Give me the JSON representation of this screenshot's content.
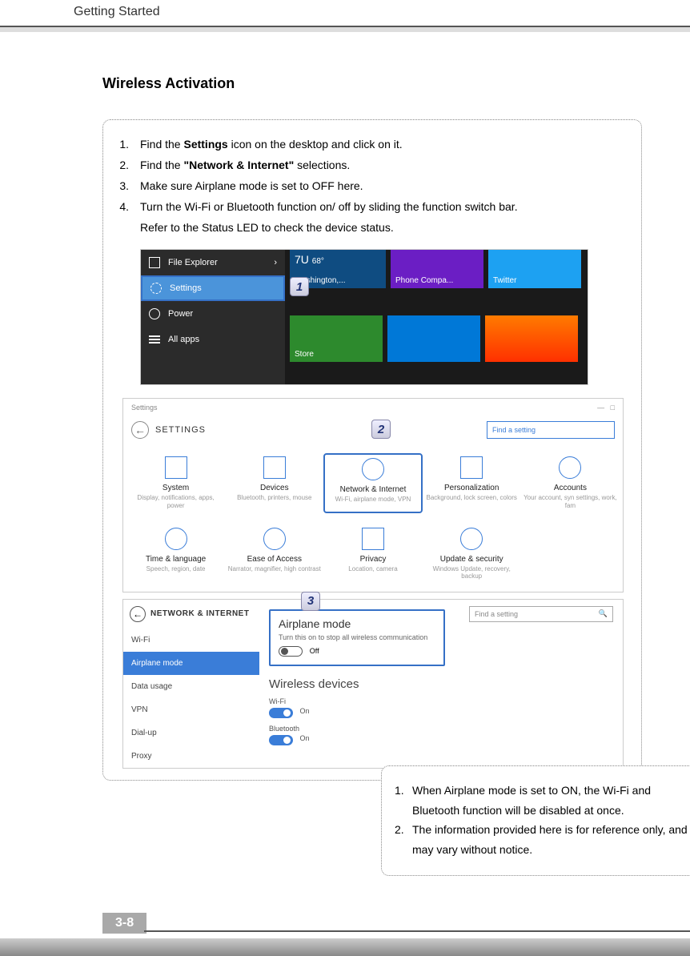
{
  "header": {
    "chapter": "Getting Started"
  },
  "section_title": "Wireless Activation",
  "steps": [
    {
      "num": "1.",
      "pre": "Find the ",
      "bold": "Settings",
      "post": " icon on the desktop and click on it."
    },
    {
      "num": "2.",
      "pre": "Find the ",
      "bold": "\"Network & Internet\"",
      "post": " selections."
    },
    {
      "num": "3.",
      "pre": "Make sure Airplane mode is set to OFF here.",
      "bold": "",
      "post": ""
    },
    {
      "num": "4.",
      "pre": "Turn the Wi-Fi or Bluetooth function on/ off by sliding the function switch bar.",
      "bold": "",
      "post": ""
    }
  ],
  "step4_line2": "Refer to the Status LED to check the device status.",
  "callouts": {
    "c1": "1",
    "c2": "2",
    "c3": "3"
  },
  "startmenu": {
    "file_explorer": "File Explorer",
    "settings": "Settings",
    "power": "Power",
    "all_apps": "All apps",
    "tiles": {
      "weather_top": "7U",
      "weather_deg": "68°",
      "weather": "Washington,...",
      "phone": "Phone Compa...",
      "twitter": "Twitter",
      "store": "Store"
    }
  },
  "settings_window": {
    "tab": "Settings",
    "title": "SETTINGS",
    "search_placeholder": "Find a setting",
    "grid": [
      {
        "label": "System",
        "sub": "Display, notifications, apps, power"
      },
      {
        "label": "Devices",
        "sub": "Bluetooth, printers, mouse"
      },
      {
        "label": "Network & Internet",
        "sub": "Wi-Fi, airplane mode, VPN"
      },
      {
        "label": "Personalization",
        "sub": "Background, lock screen, colors"
      },
      {
        "label": "Accounts",
        "sub": "Your account, syn settings, work, fam"
      },
      {
        "label": "Time & language",
        "sub": "Speech, region, date"
      },
      {
        "label": "Ease of Access",
        "sub": "Narrator, magnifier, high contrast"
      },
      {
        "label": "Privacy",
        "sub": "Location, camera"
      },
      {
        "label": "Update & security",
        "sub": "Windows Update, recovery, backup"
      }
    ]
  },
  "network_window": {
    "title": "NETWORK & INTERNET",
    "search_placeholder": "Find a setting",
    "nav": [
      "Wi-Fi",
      "Airplane mode",
      "Data usage",
      "VPN",
      "Dial-up",
      "Proxy"
    ],
    "airplane": {
      "heading": "Airplane mode",
      "desc": "Turn this on to stop all wireless communication",
      "state": "Off"
    },
    "wireless_heading": "Wireless devices",
    "wifi_label": "Wi-Fi",
    "wifi_state": "On",
    "bt_label": "Bluetooth",
    "bt_state": "On"
  },
  "notes": [
    {
      "n": "1.",
      "t": "When Airplane mode is set to ON, the Wi-Fi and Bluetooth function will be disabled at once."
    },
    {
      "n": "2.",
      "t": "The information provided here is for reference only, and may vary without notice."
    }
  ],
  "page_number": "3-8"
}
